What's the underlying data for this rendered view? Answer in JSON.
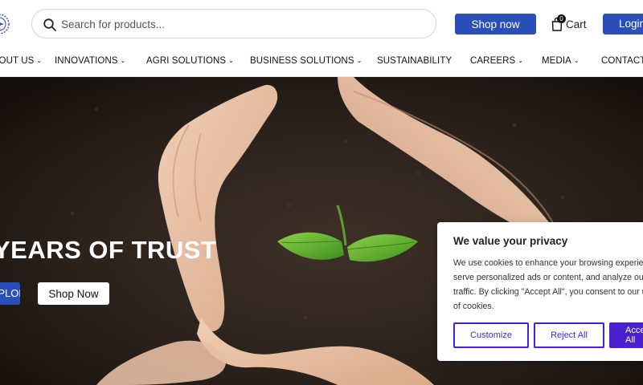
{
  "search": {
    "placeholder": "Search for products..."
  },
  "header": {
    "shop_label": "Shop now",
    "cart_label": "Cart",
    "cart_count": "0",
    "login_label": "Login"
  },
  "nav": {
    "items": [
      {
        "label": "ABOUT US",
        "chevron": true
      },
      {
        "label": "INNOVATIONS",
        "chevron": true
      },
      {
        "label": "AGRI SOLUTIONS",
        "chevron": true
      },
      {
        "label": "BUSINESS SOLUTIONS",
        "chevron": true
      },
      {
        "label": "SUSTAINABILITY",
        "chevron": false
      },
      {
        "label": "CAREERS",
        "chevron": true
      },
      {
        "label": "MEDIA",
        "chevron": true
      },
      {
        "label": "CONTACT",
        "chevron": false
      }
    ]
  },
  "hero": {
    "title": "YEARS OF TRUST",
    "explore_label": "EXPLORE",
    "shop_label": "Shop Now"
  },
  "cookie": {
    "title": "We value your privacy",
    "lines": [
      "We use cookies to enhance your browsing experience,",
      "serve personalized ads or content, and analyze our",
      "traffic. By clicking \"Accept All\", you consent to our use",
      "of cookies."
    ],
    "customize_label": "Customize",
    "reject_label": "Reject All",
    "accept_label": "Accept All"
  },
  "colors": {
    "brand_blue": "#2a4fb8",
    "consent_purple": "#4a1fd0"
  },
  "icons": {
    "search": "search-icon",
    "cart": "shopping-bag-icon",
    "logo": "company-logo"
  }
}
